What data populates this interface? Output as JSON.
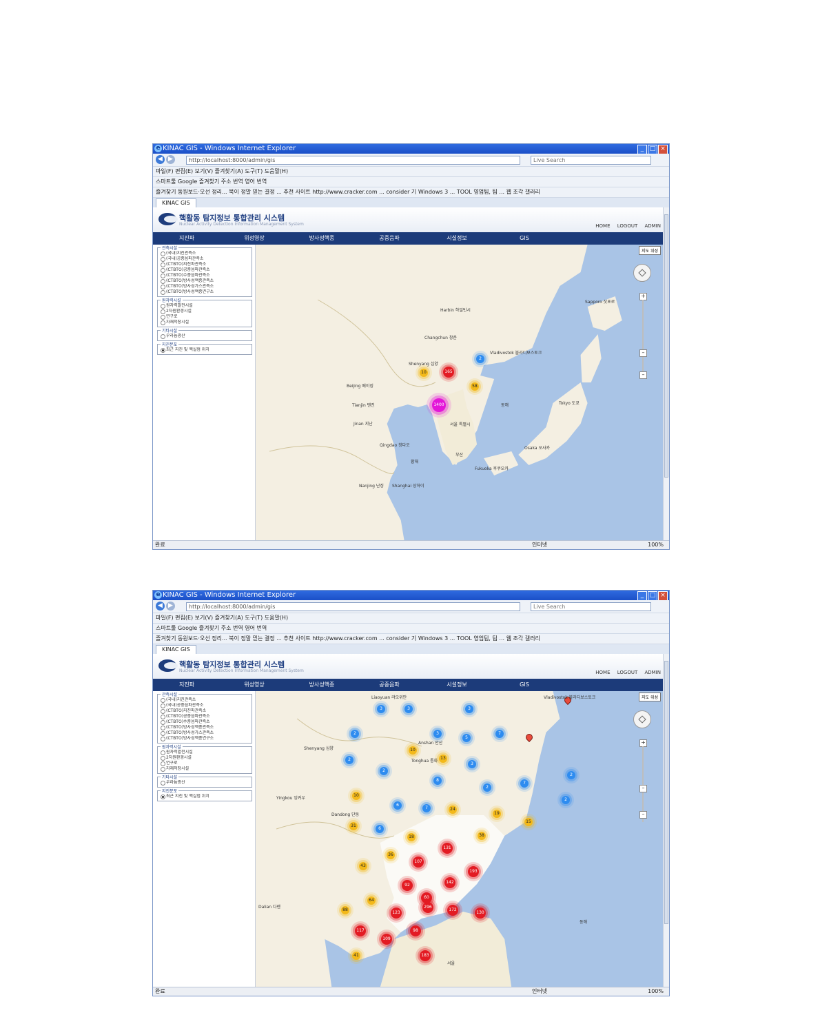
{
  "windows": [
    {
      "title": "KINAC GIS - Windows Internet Explorer",
      "address": "http://localhost:8000/admin/gis",
      "search_placeholder": "Live Search",
      "menu": "파일(F)   편집(E)   보기(V)   즐겨찾기(A)   도구(T)   도움말(H)",
      "toolbar": "스마트툴    Google    즐겨찾기  주소  번역  영어  번역",
      "favorites": "즐겨찾기   동원보드·오선 정리...   북이 정말 믿는 결정 ...   추천 사이트   http://www.cracker.com ...   consider 기 Windows 3 ...   TOOL 영업팀, 팀 ...   웹 조각 갤러리",
      "tab": "KINAC GIS",
      "status_left": "완료",
      "status_zone": "인터넷",
      "status_zoom": "100%",
      "app": {
        "title": "핵활동 탐지정보 통합관리 시스템",
        "subtitle": "Nuclear Activity Detection Information Management System",
        "links": [
          "HOME",
          "LOGOUT",
          "ADMIN"
        ],
        "nav": [
          "지진파",
          "위성영상",
          "방사성핵종",
          "공중음파",
          "시설정보",
          "GIS"
        ],
        "groups": [
          {
            "title": "관측시설",
            "options": [
              "(국내)지진관측소",
              "(국내)공중음파관측소",
              "(CTBTO)지진파관측소",
              "(CTBTO)공중음파관측소",
              "(CTBTO)수중음파관측소",
              "(CTBTO)방사성핵종관측소",
              "(CTBTO)방사성가스관측소",
              "(CTBTO)방사성핵종연구소"
            ]
          },
          {
            "title": "원자력시설",
            "options": [
              "원자력발전시설",
              "2차원환경시설",
              "연구로",
              "자재저장시설"
            ]
          },
          {
            "title": "기타시설",
            "options": [
              "우라늄광산"
            ]
          },
          {
            "title": "지진분포",
            "options": [
              "최근 지진 및 핵실험 위치"
            ],
            "selected": 0
          }
        ],
        "map_type": "지도 위성",
        "labels": [
          "Harbin 하얼빈시",
          "Changchun 창춘",
          "Shenyang 심양",
          "Beijing 베이징",
          "Tianjin 톈진",
          "Jinan 지난",
          "서울 특별시",
          "부산",
          "Fukuoka 후쿠오카",
          "Osaka 오사카",
          "Tokyo 도쿄",
          "Sapporo 삿포로",
          "Vladivostok 블라디보스토크",
          "Qingdao 칭다오",
          "Nanjing 난징",
          "Shanghai 상하이",
          "동해",
          "황해"
        ],
        "clusters": [
          {
            "label": "2",
            "color": "blue"
          },
          {
            "label": "10",
            "color": "yellow"
          },
          {
            "label": "165",
            "color": "red"
          },
          {
            "label": "58",
            "color": "yellow"
          },
          {
            "label": "1400",
            "color": "magenta"
          }
        ]
      }
    },
    {
      "title": "KINAC GIS - Windows Internet Explorer",
      "address": "http://localhost:8000/admin/gis",
      "search_placeholder": "Live Search",
      "menu": "파일(F)   편집(E)   보기(V)   즐겨찾기(A)   도구(T)   도움말(H)",
      "toolbar": "스마트툴    Google    즐겨찾기  주소  번역  영어  번역",
      "favorites": "즐겨찾기   동원보드·오선 정리...   북이 정말 믿는 결정 ...   추천 사이트   http://www.cracker.com ...   consider 기 Windows 3 ...   TOOL 영업팀, 팀 ...   웹 조각 갤러리",
      "tab": "KINAC GIS",
      "status_left": "완료",
      "status_zone": "인터넷",
      "status_zoom": "100%",
      "app": {
        "title": "핵활동 탐지정보 통합관리 시스템",
        "subtitle": "Nuclear Activity Detection Information Management System",
        "links": [
          "HOME",
          "LOGOUT",
          "ADMIN"
        ],
        "nav": [
          "지진파",
          "위성영상",
          "방사성핵종",
          "공중음파",
          "시설정보",
          "GIS"
        ],
        "groups": [
          {
            "title": "관측시설",
            "options": [
              "(국내)지진관측소",
              "(국내)공중음파관측소",
              "(CTBTO)지진파관측소",
              "(CTBTO)공중음파관측소",
              "(CTBTO)수중음파관측소",
              "(CTBTO)방사성핵종관측소",
              "(CTBTO)방사성가스관측소",
              "(CTBTO)방사성핵종연구소"
            ]
          },
          {
            "title": "원자력시설",
            "options": [
              "원자력발전시설",
              "2차원환경시설",
              "연구로",
              "자재저장시설"
            ]
          },
          {
            "title": "기타시설",
            "options": [
              "우라늄광산"
            ]
          },
          {
            "title": "지진분포",
            "options": [
              "최근 지진 및 핵실험 위치"
            ],
            "selected": 0
          }
        ],
        "map_type": "지도 위성",
        "labels": [
          "Liaoyuan 랴오위안",
          "Shenyang 심양",
          "Anshan 안산",
          "Dandong 단둥",
          "Tonghua 퉁화",
          "Vladivostok 블라디보스토크",
          "Dalian 다롄",
          "Yingkou 잉커우",
          "서울",
          "동해"
        ],
        "clusters": [
          {
            "label": "3",
            "color": "blue"
          },
          {
            "label": "3",
            "color": "blue"
          },
          {
            "label": "3",
            "color": "blue"
          },
          {
            "label": "2",
            "color": "blue"
          },
          {
            "label": "3",
            "color": "blue"
          },
          {
            "label": "5",
            "color": "blue"
          },
          {
            "label": "7",
            "color": "blue"
          },
          {
            "label": "2",
            "color": "blue"
          },
          {
            "label": "10",
            "color": "yellow"
          },
          {
            "label": "13",
            "color": "yellow"
          },
          {
            "label": "3",
            "color": "blue"
          },
          {
            "label": "2",
            "color": "blue"
          },
          {
            "label": "8",
            "color": "blue"
          },
          {
            "label": "2",
            "color": "blue"
          },
          {
            "label": "7",
            "color": "blue"
          },
          {
            "label": "2",
            "color": "blue"
          },
          {
            "label": "2",
            "color": "blue"
          },
          {
            "label": "10",
            "color": "yellow"
          },
          {
            "label": "6",
            "color": "blue"
          },
          {
            "label": "7",
            "color": "blue"
          },
          {
            "label": "24",
            "color": "yellow"
          },
          {
            "label": "19",
            "color": "yellow"
          },
          {
            "label": "15",
            "color": "yellow"
          },
          {
            "label": "31",
            "color": "yellow"
          },
          {
            "label": "6",
            "color": "blue"
          },
          {
            "label": "18",
            "color": "yellow"
          },
          {
            "label": "131",
            "color": "red"
          },
          {
            "label": "38",
            "color": "yellow"
          },
          {
            "label": "36",
            "color": "yellow"
          },
          {
            "label": "107",
            "color": "red"
          },
          {
            "label": "43",
            "color": "yellow"
          },
          {
            "label": "193",
            "color": "red"
          },
          {
            "label": "92",
            "color": "red"
          },
          {
            "label": "142",
            "color": "red"
          },
          {
            "label": "60",
            "color": "red"
          },
          {
            "label": "64",
            "color": "yellow"
          },
          {
            "label": "88",
            "color": "yellow"
          },
          {
            "label": "123",
            "color": "red"
          },
          {
            "label": "296",
            "color": "red"
          },
          {
            "label": "172",
            "color": "red"
          },
          {
            "label": "130",
            "color": "red"
          },
          {
            "label": "117",
            "color": "red"
          },
          {
            "label": "109",
            "color": "red"
          },
          {
            "label": "98",
            "color": "red"
          },
          {
            "label": "41",
            "color": "yellow"
          },
          {
            "label": "183",
            "color": "red"
          }
        ]
      }
    }
  ],
  "colors": {
    "red": "#e31b23",
    "blue": "#2e8cf0",
    "yellow": "#f3b91a",
    "magenta": "#e316d8",
    "navbar": "#1c3b7a"
  }
}
